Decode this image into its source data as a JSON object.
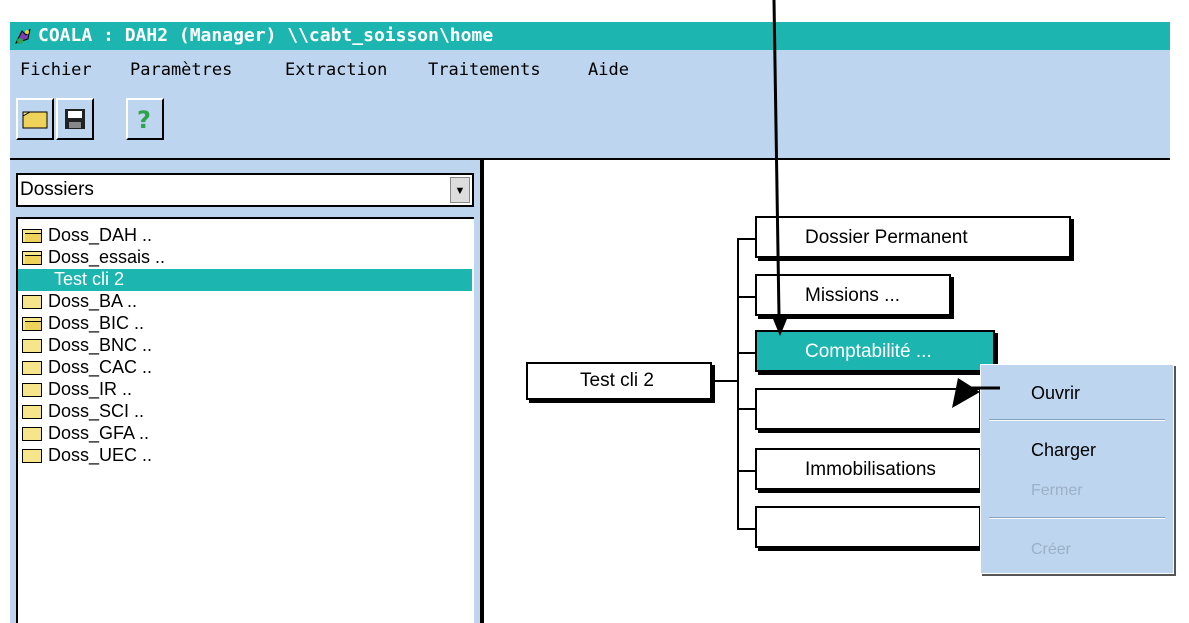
{
  "window": {
    "title": "COALA : DAH2 (Manager) \\\\cabt_soisson\\home",
    "title_bar_color": "#1db5b0",
    "chrome_color": "#bdd5ee",
    "selection_color": "#1db5b0"
  },
  "menu": [
    "Fichier",
    "Paramètres",
    "Extraction",
    "Traitements",
    "Aide"
  ],
  "toolbar": {
    "buttons": [
      {
        "name": "open-folder-icon"
      },
      {
        "name": "save-icon"
      },
      {
        "name": "help-icon"
      }
    ],
    "help_glyph": "?"
  },
  "left_panel": {
    "combo_value": "Dossiers",
    "tree": [
      {
        "label": "Doss_DAH ..",
        "icon": "folder-open-icon"
      },
      {
        "label": "Doss_essais ..",
        "icon": "folder-open-icon"
      },
      {
        "label": "Test cli 2",
        "icon": "",
        "selected": true
      },
      {
        "label": "Doss_BA ..",
        "icon": "folder-icon"
      },
      {
        "label": "Doss_BIC ..",
        "icon": "folder-open-icon"
      },
      {
        "label": "Doss_BNC ..",
        "icon": "folder-icon"
      },
      {
        "label": "Doss_CAC ..",
        "icon": "folder-icon"
      },
      {
        "label": "Doss_IR ..",
        "icon": "folder-icon"
      },
      {
        "label": "Doss_SCI ..",
        "icon": "folder-icon"
      },
      {
        "label": "Doss_GFA ..",
        "icon": "folder-icon"
      },
      {
        "label": "Doss_UEC ..",
        "icon": "folder-icon"
      }
    ]
  },
  "diagram": {
    "root": "Test cli 2",
    "children": [
      "Dossier Permanent",
      "Missions ...",
      "Comptabilité ...",
      "",
      "Immobilisations",
      ""
    ],
    "selected_child": "Comptabilité ..."
  },
  "context_menu": {
    "ouvrir": "Ouvrir",
    "charger": "Charger",
    "fermer": "Fermer",
    "creer": "Créer"
  }
}
